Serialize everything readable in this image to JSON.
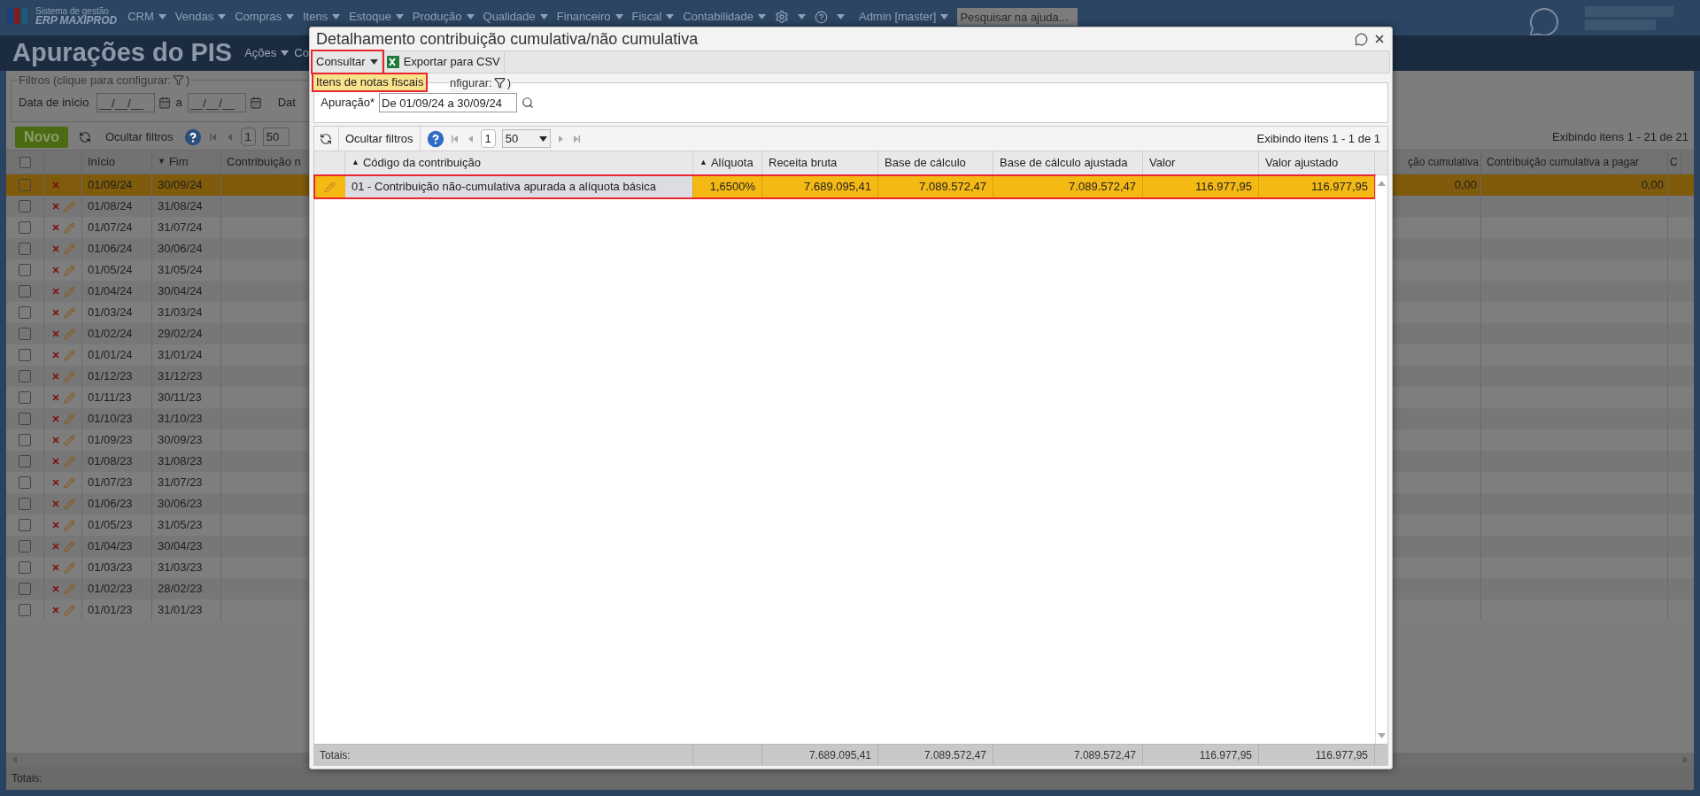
{
  "nav": {
    "logo_line1": "Sistema de gestão",
    "logo_line2": "ERP MAXIPROD",
    "menus": [
      {
        "label": "CRM"
      },
      {
        "label": "Vendas"
      },
      {
        "label": "Compras"
      },
      {
        "label": "Itens"
      },
      {
        "label": "Estoque"
      },
      {
        "label": "Produção"
      },
      {
        "label": "Qualidade"
      },
      {
        "label": "Financeiro"
      },
      {
        "label": "Fiscal"
      },
      {
        "label": "Contabilidade"
      }
    ],
    "user": "Admin [master]",
    "search": {
      "placeholder": "Pesquisar na ajuda..."
    }
  },
  "page": {
    "title": "Apurações do PIS",
    "actions": "Ações",
    "actions_cut": "Co",
    "filters": {
      "legend": "Filtros (clique para configurar:",
      "legend_end": ")",
      "start_label": "Data de início",
      "start_value": "__/__/__",
      "separator": "a",
      "end_value": "__/__/__",
      "next_label": "Dat"
    },
    "toolbar": {
      "new": "Novo",
      "hide_filters": "Ocultar filtros",
      "page": "1",
      "page_size": "50",
      "status": "Exibindo itens 1 - 21 de 21"
    },
    "table": {
      "header_checked": false,
      "columns_left": [
        {
          "label": "Início"
        },
        {
          "label": "Fim",
          "sort": "▼"
        },
        {
          "label": "Contribuição n"
        }
      ],
      "columns_right": [
        {
          "label": "ção cumulativa"
        },
        {
          "label": "Contribuição cumulativa a pagar"
        },
        {
          "label": "C"
        }
      ],
      "rows": [
        {
          "start": "01/09/24",
          "end": "30/09/24",
          "checked": false,
          "selected": true,
          "values": [
            "0,00",
            "0,00"
          ]
        },
        {
          "start": "01/08/24",
          "end": "31/08/24",
          "checked": false,
          "selected": false
        },
        {
          "start": "01/07/24",
          "end": "31/07/24",
          "checked": false,
          "selected": false
        },
        {
          "start": "01/06/24",
          "end": "30/06/24",
          "checked": false,
          "selected": false
        },
        {
          "start": "01/05/24",
          "end": "31/05/24",
          "checked": false,
          "selected": false
        },
        {
          "start": "01/04/24",
          "end": "30/04/24",
          "checked": false,
          "selected": false
        },
        {
          "start": "01/03/24",
          "end": "31/03/24",
          "checked": false,
          "selected": false
        },
        {
          "start": "01/02/24",
          "end": "29/02/24",
          "checked": false,
          "selected": false
        },
        {
          "start": "01/01/24",
          "end": "31/01/24",
          "checked": false,
          "selected": false
        },
        {
          "start": "01/12/23",
          "end": "31/12/23",
          "checked": false,
          "selected": false
        },
        {
          "start": "01/11/23",
          "end": "30/11/23",
          "checked": false,
          "selected": false
        },
        {
          "start": "01/10/23",
          "end": "31/10/23",
          "checked": false,
          "selected": false
        },
        {
          "start": "01/09/23",
          "end": "30/09/23",
          "checked": false,
          "selected": false
        },
        {
          "start": "01/08/23",
          "end": "31/08/23",
          "checked": false,
          "selected": false
        },
        {
          "start": "01/07/23",
          "end": "31/07/23",
          "checked": false,
          "selected": false
        },
        {
          "start": "01/06/23",
          "end": "30/06/23",
          "checked": false,
          "selected": false
        },
        {
          "start": "01/05/23",
          "end": "31/05/23",
          "checked": false,
          "selected": false
        },
        {
          "start": "01/04/23",
          "end": "30/04/23",
          "checked": false,
          "selected": false
        },
        {
          "start": "01/03/23",
          "end": "31/03/23",
          "checked": false,
          "selected": false
        },
        {
          "start": "01/02/23",
          "end": "28/02/23",
          "checked": false,
          "selected": false
        },
        {
          "start": "01/01/23",
          "end": "31/01/23",
          "checked": false,
          "selected": false
        }
      ],
      "totals_label": "Totais:"
    }
  },
  "dialog": {
    "title": "Detalhamento contribuição cumulativa/não cumulativa",
    "toolbar": {
      "consult": "Consultar",
      "consult_highlighted": true,
      "export": "Exportar para CSV"
    },
    "menu": [
      {
        "label": "Itens de notas fiscais",
        "selected": true,
        "highlighted": true
      }
    ],
    "filter": {
      "legend": "nfigurar:",
      "legend_end": ")",
      "label": "Apuração*",
      "value": "De 01/09/24 a 30/09/24"
    },
    "grid_toolbar": {
      "hide_filters": "Ocultar filtros",
      "page": "1",
      "page_size": "50",
      "status": "Exibindo itens 1 - 1 de 1"
    },
    "columns": [
      {
        "label": "Código da contribuição",
        "sort": "▲"
      },
      {
        "label": "Alíquota",
        "sort": "▲"
      },
      {
        "label": "Receita bruta"
      },
      {
        "label": "Base de cálculo"
      },
      {
        "label": "Base de cálculo ajustada"
      },
      {
        "label": "Valor"
      },
      {
        "label": "Valor ajustado"
      }
    ],
    "rows": [
      {
        "cells": [
          "01 - Contribuição não-cumulativa apurada a alíquota básica",
          "1,6500%",
          "7.689.095,41",
          "7.089.572,47",
          "7.089.572,47",
          "116.977,95",
          "116.977,95"
        ],
        "selected": true,
        "highlighted": true
      }
    ],
    "totals": {
      "label": "Totais:",
      "values": [
        "7.689.095,41",
        "7.089.572,47",
        "7.089.572,47",
        "116.977,95",
        "116.977,95"
      ]
    }
  }
}
